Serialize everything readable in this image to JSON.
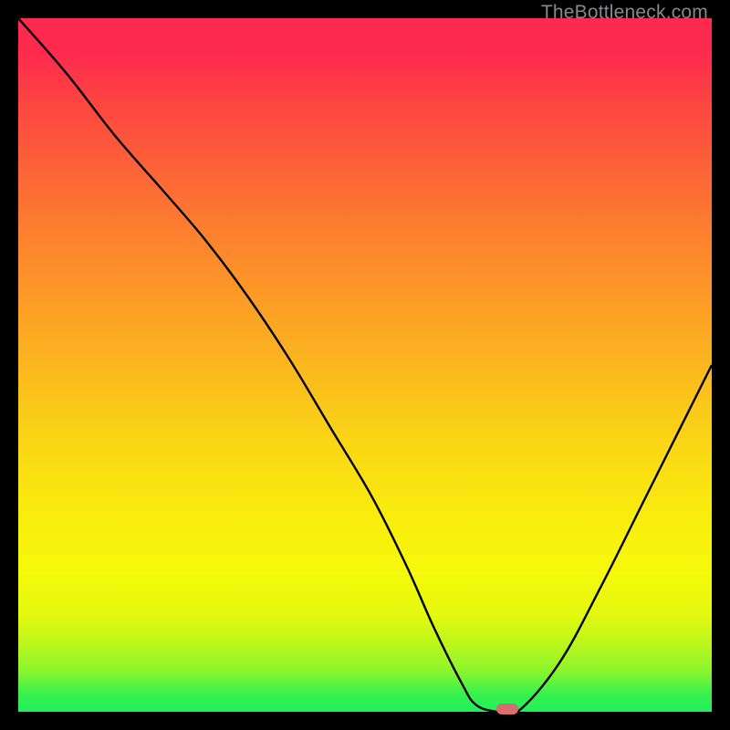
{
  "watermark": "TheBottleneck.com",
  "chart_data": {
    "type": "line",
    "title": "",
    "xlabel": "",
    "ylabel": "",
    "xlim": [
      0,
      100
    ],
    "ylim": [
      0,
      100
    ],
    "series": [
      {
        "name": "curve",
        "x": [
          0,
          7,
          14,
          21,
          27,
          33,
          39,
          45,
          51,
          56,
          60,
          64,
          66,
          69,
          72,
          78,
          84,
          90,
          96,
          100
        ],
        "y": [
          100,
          92,
          83,
          75,
          68,
          60,
          51,
          41,
          31,
          21,
          12,
          4,
          1,
          0,
          0,
          7,
          18,
          30,
          42,
          50
        ]
      }
    ],
    "marker": {
      "x": 70.5,
      "y": 0
    },
    "gradient_stops": [
      {
        "pct": 0,
        "color": "#fe2a4e"
      },
      {
        "pct": 22,
        "color": "#fd6437"
      },
      {
        "pct": 48,
        "color": "#fbb120"
      },
      {
        "pct": 72,
        "color": "#f9ed0d"
      },
      {
        "pct": 90,
        "color": "#bdf71b"
      },
      {
        "pct": 100,
        "color": "#1ff059"
      }
    ]
  }
}
